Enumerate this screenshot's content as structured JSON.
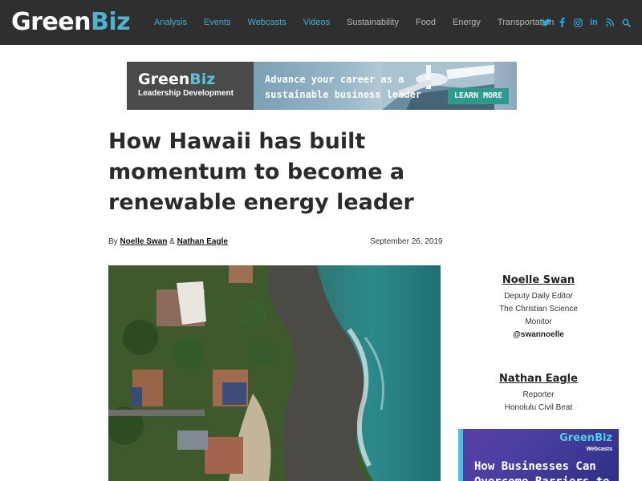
{
  "site": {
    "logo_green": "Green",
    "logo_biz": "Biz"
  },
  "nav": {
    "items": [
      {
        "label": "Analysis",
        "style": "hl"
      },
      {
        "label": "Events",
        "style": "hl"
      },
      {
        "label": "Webcasts",
        "style": "hl"
      },
      {
        "label": "Videos",
        "style": "hl"
      },
      {
        "label": "Sustainability",
        "style": "dim"
      },
      {
        "label": "Food",
        "style": "dim"
      },
      {
        "label": "Energy",
        "style": "dim"
      },
      {
        "label": "Transportation",
        "style": "dim"
      }
    ],
    "social_icons": [
      "twitter-icon",
      "facebook-icon",
      "instagram-icon",
      "linkedin-icon",
      "rss-icon",
      "search-icon"
    ],
    "linkedin_text": "in",
    "accent": "#3fb0d6"
  },
  "banner": {
    "logo_green": "Green",
    "logo_biz": "Biz",
    "subtitle": "Leadership Development",
    "tagline_1": "Advance your career as a",
    "tagline_2": "sustainable business leader",
    "cta": "LEARN MORE"
  },
  "article": {
    "title": "How Hawaii has built momentum to become a renewable energy leader",
    "by": "By",
    "author_1": "Noelle Swan",
    "amp": "&",
    "author_2": "Nathan Eagle",
    "date": "September 26, 2019"
  },
  "authors": [
    {
      "name": "Noelle Swan",
      "role": "Deputy Daily Editor",
      "org_1": "The Christian Science",
      "org_2": "Monitor",
      "handle": "@swannoelle"
    },
    {
      "name": "Nathan Eagle",
      "role": "Reporter",
      "org_1": "Honolulu Civil Beat"
    }
  ],
  "ad": {
    "logo_green": "GreenBiz",
    "logo_sub": "Webcasts",
    "title_1": "How Businesses Can",
    "title_2": "Overcome Barriers to"
  }
}
